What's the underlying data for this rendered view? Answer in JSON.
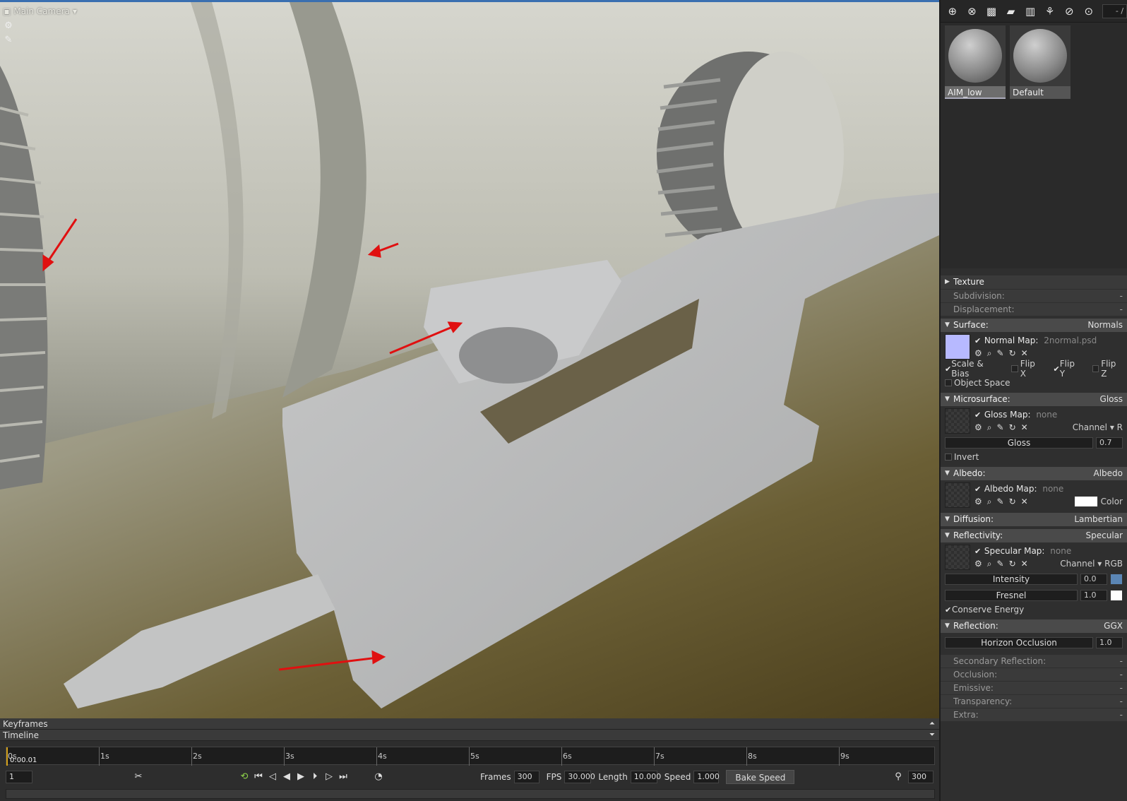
{
  "viewport": {
    "camera_label": "Main Camera",
    "tools": [
      "gear-icon",
      "brush-icon"
    ]
  },
  "toolbar": {
    "icons": [
      "add-icon",
      "duplicate-icon",
      "checker-icon",
      "folder-icon",
      "trash-icon",
      "merge-icon",
      "select-icon",
      "link-icon"
    ],
    "field": "- /"
  },
  "materials": [
    {
      "name": "AIM_low",
      "selected": true
    },
    {
      "name": "Default",
      "selected": false
    }
  ],
  "panel": {
    "texture": "Texture",
    "subdivision": {
      "label": "Subdivision:",
      "value": "-"
    },
    "displacement": {
      "label": "Displacement:",
      "value": "-"
    },
    "surface": {
      "label": "Surface:",
      "value": "Normals",
      "map_label": "Normal Map:",
      "map_value": "2normal.psd",
      "scale_bias": "Scale & Bias",
      "flip_x": "Flip X",
      "flip_y": "Flip Y",
      "flip_z": "Flip Z",
      "object_space": "Object Space"
    },
    "microsurface": {
      "label": "Microsurface:",
      "value": "Gloss",
      "map_label": "Gloss Map:",
      "map_value": "none",
      "channel_label": "Channel",
      "channel_value": "R",
      "slider_label": "Gloss",
      "slider_value": "0.7",
      "invert": "Invert"
    },
    "albedo": {
      "label": "Albedo:",
      "value": "Albedo",
      "map_label": "Albedo Map:",
      "map_value": "none",
      "color_label": "Color",
      "color": "#ffffff"
    },
    "diffusion": {
      "label": "Diffusion:",
      "value": "Lambertian"
    },
    "reflectivity": {
      "label": "Reflectivity:",
      "value": "Specular",
      "map_label": "Specular Map:",
      "map_value": "none",
      "channel_label": "Channel",
      "channel_value": "RGB",
      "intensity_label": "Intensity",
      "intensity_value": "0.0",
      "intensity_color": "#5b86b5",
      "fresnel_label": "Fresnel",
      "fresnel_value": "1.0",
      "fresnel_color": "#ffffff",
      "conserve": "Conserve Energy"
    },
    "reflection": {
      "label": "Reflection:",
      "value": "GGX",
      "horizon_label": "Horizon Occlusion",
      "horizon_value": "1.0"
    },
    "secondary_reflection": {
      "label": "Secondary Reflection:",
      "value": "-"
    },
    "occlusion": {
      "label": "Occlusion:",
      "value": "-"
    },
    "emissive": {
      "label": "Emissive:",
      "value": "-"
    },
    "transparency": {
      "label": "Transparency:",
      "value": "-"
    },
    "extra": {
      "label": "Extra:",
      "value": "-"
    }
  },
  "timeline": {
    "keyframes_label": "Keyframes",
    "timeline_label": "Timeline",
    "ticks": [
      "0s",
      "1s",
      "2s",
      "3s",
      "4s",
      "5s",
      "6s",
      "7s",
      "8s",
      "9s"
    ],
    "timecode": "0:00.01",
    "frame_field": "1",
    "frames_label": "Frames",
    "frames_value": "300",
    "fps_label": "FPS",
    "fps_value": "30.000",
    "length_label": "Length",
    "length_value": "10.000",
    "speed_label": "Speed",
    "speed_value": "1.000",
    "bake_label": "Bake Speed",
    "end_value": "300"
  }
}
